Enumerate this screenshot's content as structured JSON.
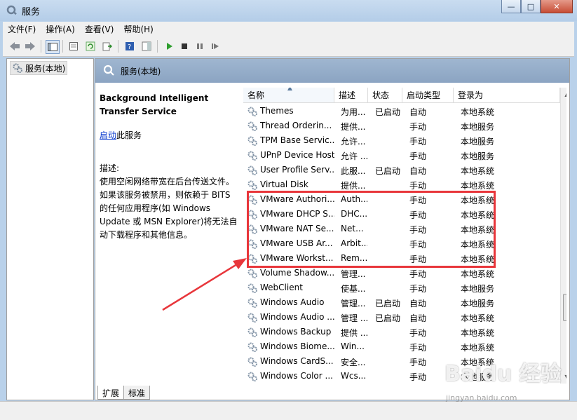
{
  "window": {
    "title": "服务",
    "buttons": {
      "minimize": "—",
      "maximize": "□",
      "close": "✕"
    }
  },
  "menu": [
    "文件(F)",
    "操作(A)",
    "查看(V)",
    "帮助(H)"
  ],
  "tree": {
    "item": "服务(本地)"
  },
  "main": {
    "header_title": "服务(本地)"
  },
  "description": {
    "title": "Background Intelligent Transfer Service",
    "start_link": "启动",
    "start_suffix": "此服务",
    "label": "描述:",
    "text": "使用空闲网络带宽在后台传送文件。如果该服务被禁用，则依赖于 BITS 的任何应用程序(如 Windows Update 或 MSN Explorer)将无法自动下载程序和其他信息。"
  },
  "columns": [
    "名称",
    "描述",
    "状态",
    "启动类型",
    "登录为"
  ],
  "rows": [
    {
      "name": "Themes",
      "desc": "为用...",
      "status": "已启动",
      "startup": "自动",
      "logon": "本地系统"
    },
    {
      "name": "Thread Orderin...",
      "desc": "提供...",
      "status": "",
      "startup": "手动",
      "logon": "本地服务"
    },
    {
      "name": "TPM Base Servic...",
      "desc": "允许...",
      "status": "",
      "startup": "手动",
      "logon": "本地服务"
    },
    {
      "name": "UPnP Device Host",
      "desc": "允许 ...",
      "status": "",
      "startup": "手动",
      "logon": "本地服务"
    },
    {
      "name": "User Profile Serv...",
      "desc": "此服...",
      "status": "已启动",
      "startup": "自动",
      "logon": "本地系统"
    },
    {
      "name": "Virtual Disk",
      "desc": "提供...",
      "status": "",
      "startup": "手动",
      "logon": "本地系统"
    },
    {
      "name": "VMware Authori...",
      "desc": "Auth...",
      "status": "",
      "startup": "手动",
      "logon": "本地系统"
    },
    {
      "name": "VMware DHCP S...",
      "desc": "DHC...",
      "status": "",
      "startup": "手动",
      "logon": "本地系统"
    },
    {
      "name": "VMware NAT Se...",
      "desc": "Net...",
      "status": "",
      "startup": "手动",
      "logon": "本地系统"
    },
    {
      "name": "VMware USB Ar...",
      "desc": "Arbit...",
      "status": "",
      "startup": "手动",
      "logon": "本地系统"
    },
    {
      "name": "VMware Workst...",
      "desc": "Rem...",
      "status": "",
      "startup": "手动",
      "logon": "本地系统"
    },
    {
      "name": "Volume Shadow...",
      "desc": "管理...",
      "status": "",
      "startup": "手动",
      "logon": "本地系统"
    },
    {
      "name": "WebClient",
      "desc": "使基...",
      "status": "",
      "startup": "手动",
      "logon": "本地服务"
    },
    {
      "name": "Windows Audio",
      "desc": "管理...",
      "status": "已启动",
      "startup": "自动",
      "logon": "本地服务"
    },
    {
      "name": "Windows Audio ...",
      "desc": "管理 ...",
      "status": "已启动",
      "startup": "自动",
      "logon": "本地系统"
    },
    {
      "name": "Windows Backup",
      "desc": "提供 ...",
      "status": "",
      "startup": "手动",
      "logon": "本地系统"
    },
    {
      "name": "Windows Biome...",
      "desc": "Win...",
      "status": "",
      "startup": "手动",
      "logon": "本地系统"
    },
    {
      "name": "Windows CardS...",
      "desc": "安全...",
      "status": "",
      "startup": "手动",
      "logon": "本地系统"
    },
    {
      "name": "Windows Color ...",
      "desc": "Wcs...",
      "status": "",
      "startup": "手动",
      "logon": "本地服务"
    }
  ],
  "tabs": [
    "扩展",
    "标准"
  ],
  "watermark": {
    "text": "Baidu 经验",
    "sub": "jingyan.baidu.com"
  }
}
